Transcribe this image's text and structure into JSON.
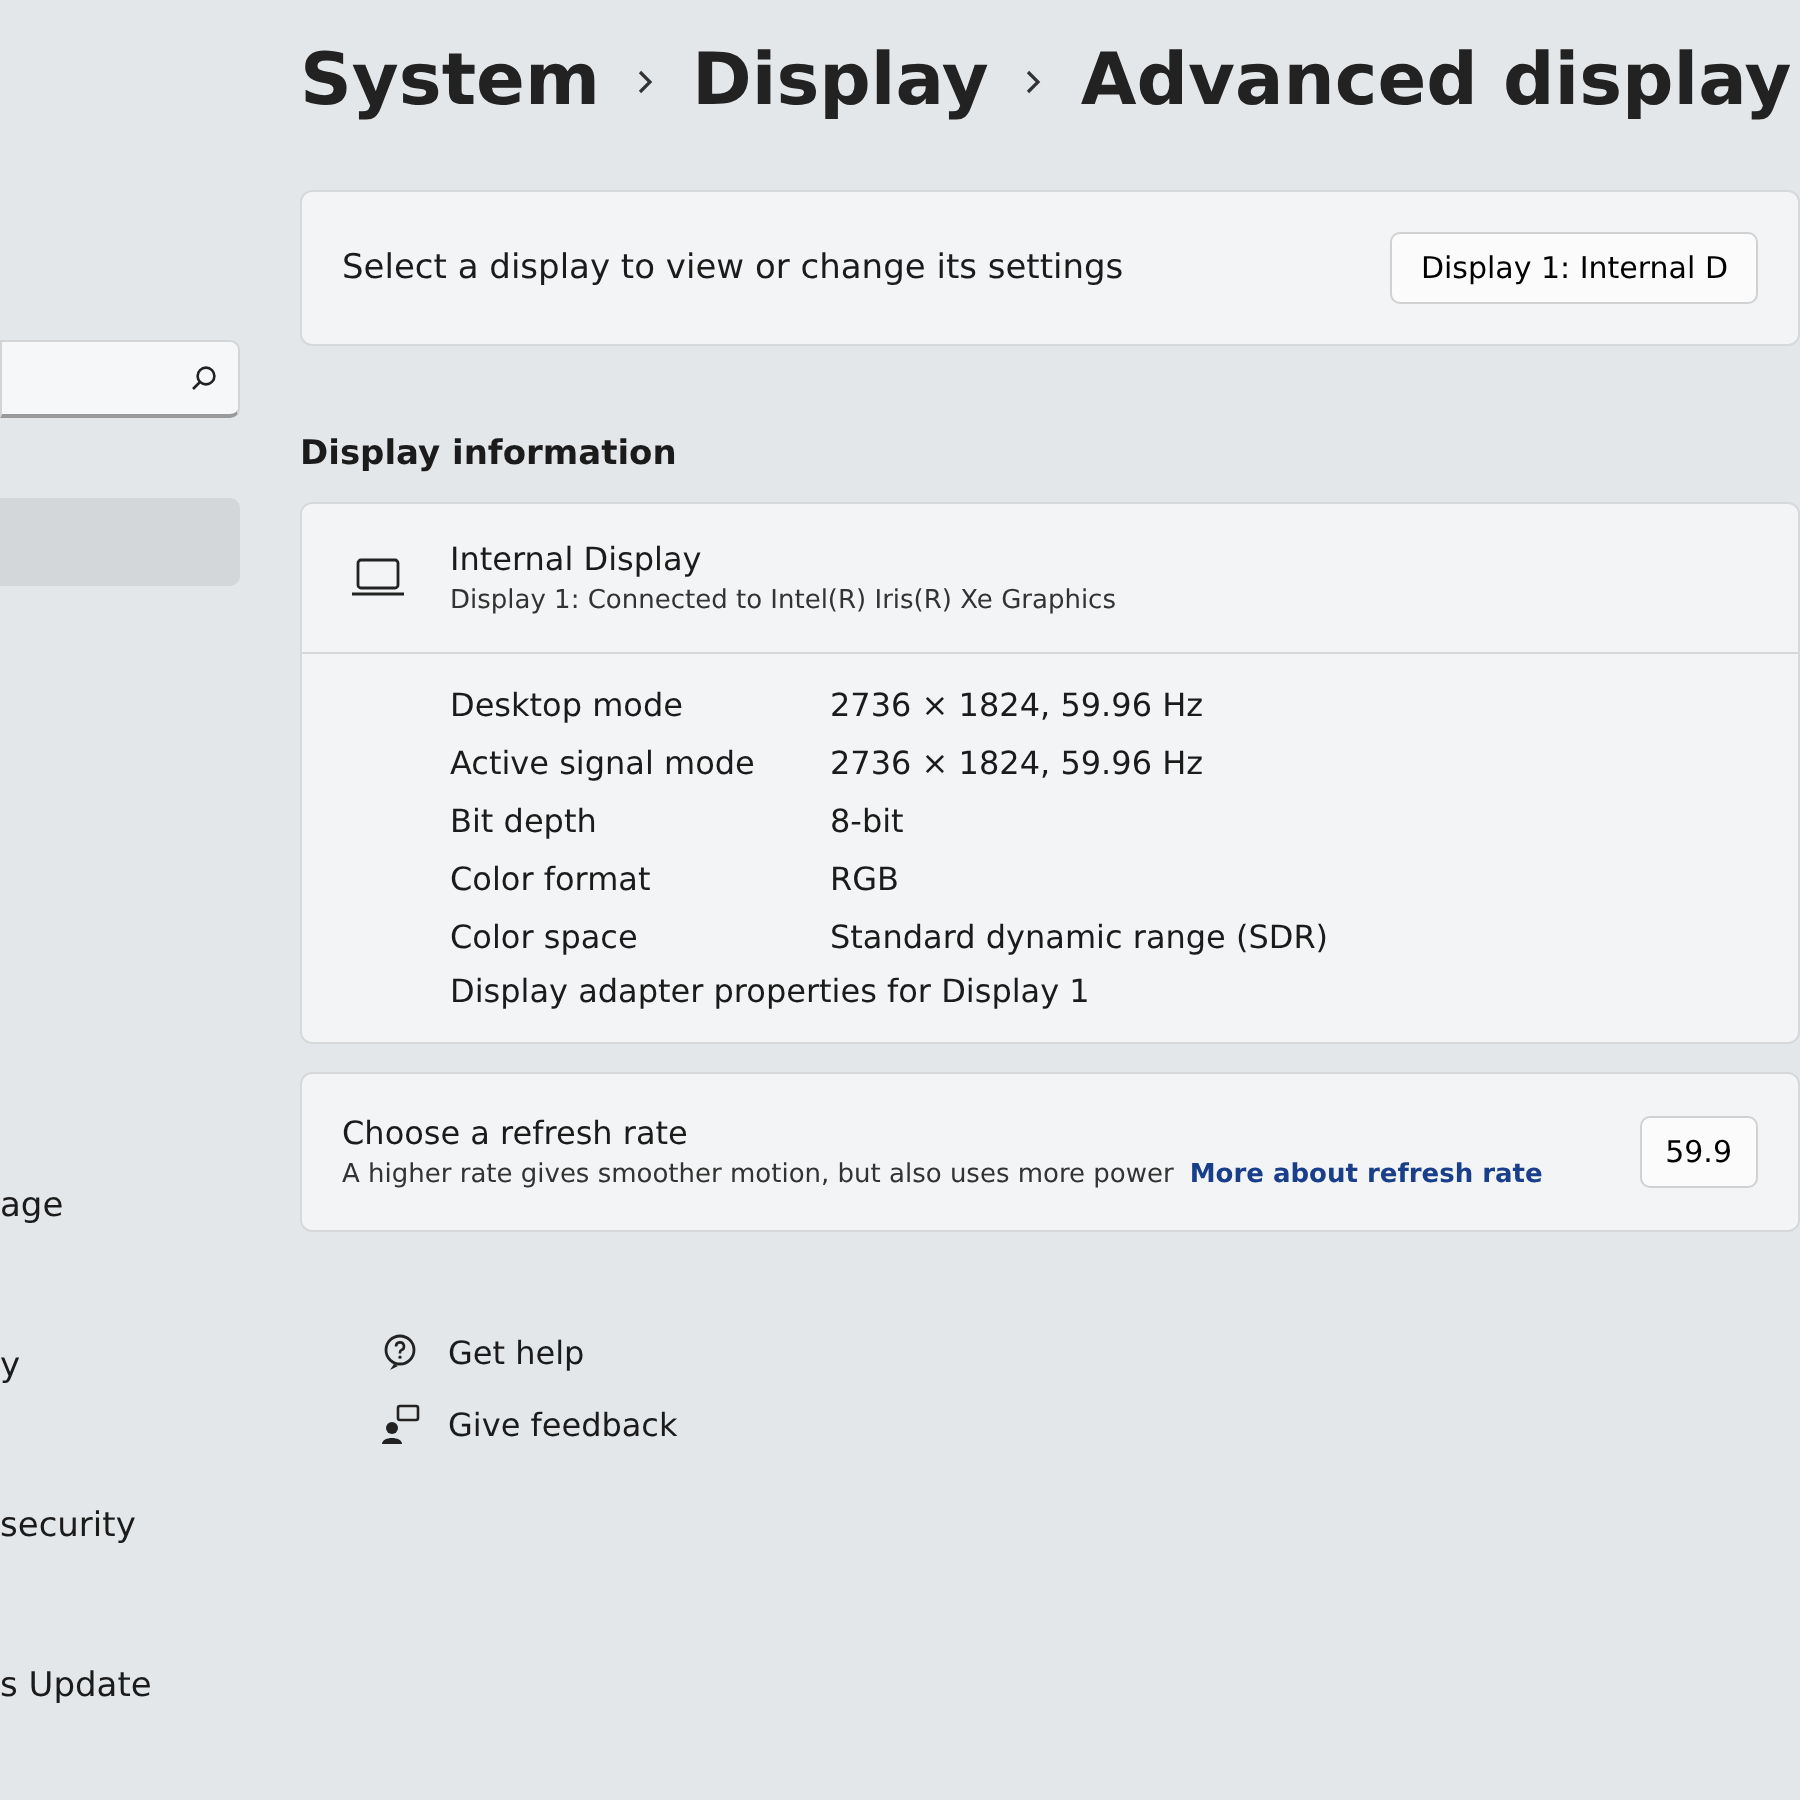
{
  "breadcrumb": [
    "System",
    "Display",
    "Advanced display"
  ],
  "sidebar": {
    "items": [
      {
        "label": "age"
      },
      {
        "label": "y"
      },
      {
        "label": "security"
      },
      {
        "label": "s Update"
      }
    ]
  },
  "display_select": {
    "label": "Select a display to view or change its settings",
    "value": "Display 1: Internal D"
  },
  "section_title": "Display information",
  "display": {
    "name": "Internal Display",
    "subtitle": "Display 1: Connected to Intel(R) Iris(R) Xe Graphics",
    "rows": [
      {
        "label": "Desktop mode",
        "value": "2736 × 1824, 59.96 Hz"
      },
      {
        "label": "Active signal mode",
        "value": "2736 × 1824, 59.96 Hz"
      },
      {
        "label": "Bit depth",
        "value": "8-bit"
      },
      {
        "label": "Color format",
        "value": "RGB"
      },
      {
        "label": "Color space",
        "value": "Standard dynamic range (SDR)"
      }
    ],
    "link": "Display adapter properties for Display 1"
  },
  "refresh_rate": {
    "title": "Choose a refresh rate",
    "description": "A higher rate gives smoother motion, but also uses more power",
    "link": "More about refresh rate",
    "value": "59.9"
  },
  "help_links": [
    {
      "kind": "help",
      "label": "Get help"
    },
    {
      "kind": "feedback",
      "label": "Give feedback"
    }
  ]
}
